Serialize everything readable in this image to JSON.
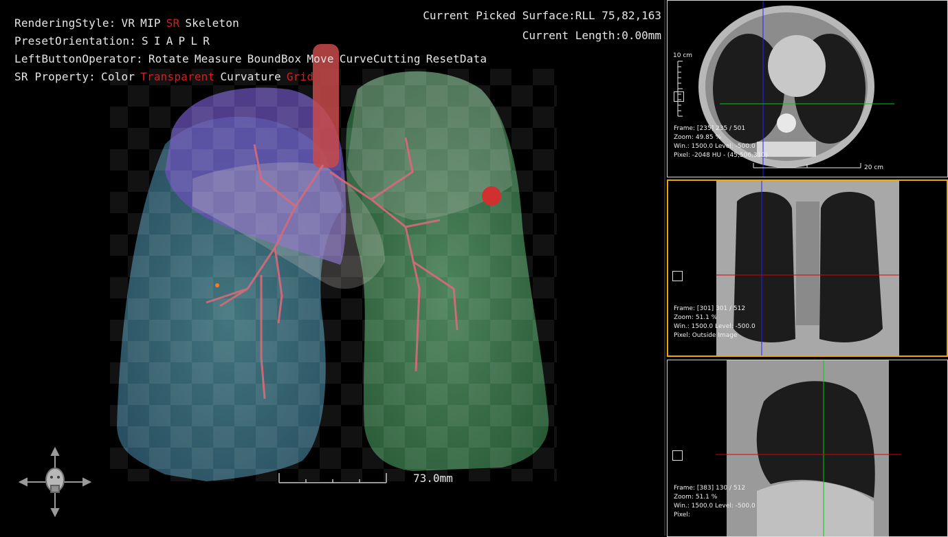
{
  "menu": {
    "rendering": {
      "label": "RenderingStyle:",
      "options": [
        "VR",
        "MIP",
        "SR",
        "Skeleton"
      ]
    },
    "orientation": {
      "label": "PresetOrientation:",
      "options": [
        "S",
        "I",
        "A",
        "P",
        "L",
        "R"
      ]
    },
    "left_button": {
      "label": "LeftButtonOperator:",
      "options": [
        "Rotate",
        "Measure",
        "BoundBox",
        "Move",
        "CurveCutting",
        "ResetData"
      ]
    },
    "sr_property": {
      "label": "SR Property:",
      "options": [
        "Color",
        "Transparent",
        "Curvature",
        "Grid"
      ]
    }
  },
  "status": {
    "picked_surface": "Current Picked Surface:RLL 75,82,163",
    "length": "Current Length:0.00mm"
  },
  "scale_bar_label": "73.0mm",
  "colors": {
    "active_option": "#d22020",
    "normal_text": "#e6e6e6",
    "active_pane_border": "#f0a800",
    "crosshair_blue": "#2020ff",
    "crosshair_green": "#00d000",
    "crosshair_red": "#e00000"
  },
  "panes": {
    "axial": {
      "frame": "Frame: [235] 235 / 501",
      "zoom": "Zoom: 49.85 %",
      "win": "Win.: 1500.0 Level: -500.0",
      "pixel": "Pixel: -2048 HU - (45,506,310)",
      "ruler_v": "10 cm",
      "ruler_h": "20 cm"
    },
    "coronal": {
      "frame": "Frame: [301] 301 / 512",
      "zoom": "Zoom: 51.1 %",
      "win": "Win.: 1500.0 Level: -500.0",
      "pixel": "Pixel: Outside Image"
    },
    "sagittal": {
      "frame": "Frame: [383] 130 / 512",
      "zoom": "Zoom: 51.1 %",
      "win": "Win.: 1500.0 Level: -500.0",
      "pixel": "Pixel:"
    }
  },
  "icons": {
    "orientation_widget": "head-orientation-icon"
  }
}
